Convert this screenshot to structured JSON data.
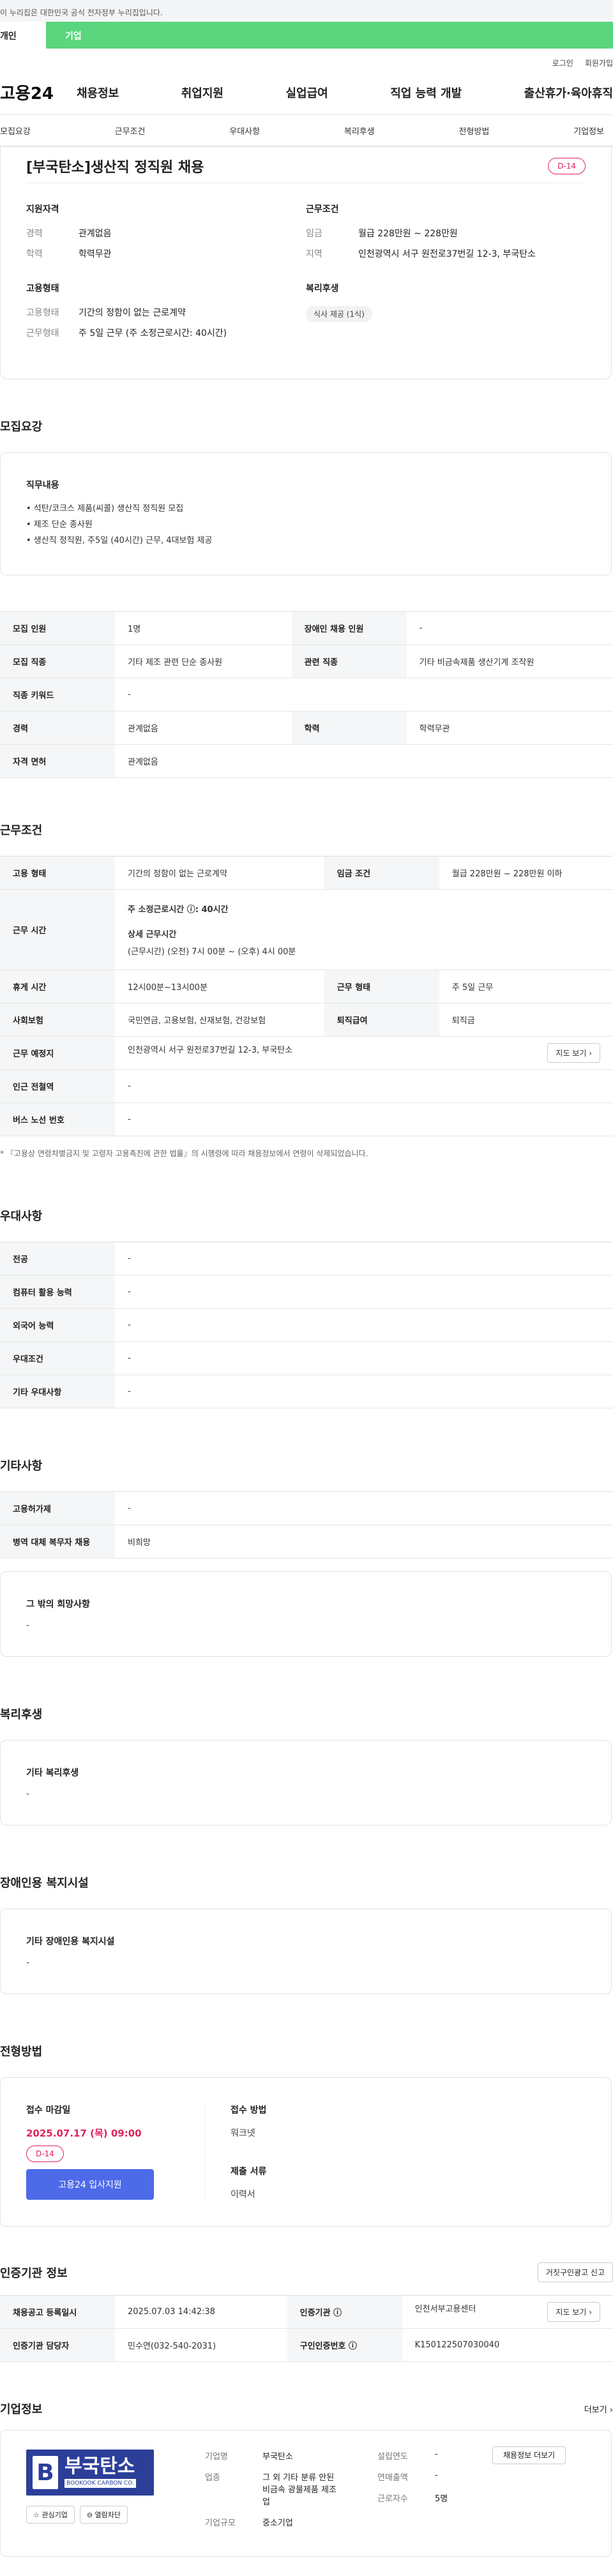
{
  "topbar": {
    "notice": "이 누리집은 대한민국 공식 전자정부 누리집입니다."
  },
  "audience_tabs": {
    "left": "개인",
    "right": "기업"
  },
  "utility": {
    "login": "로그인",
    "signup": "회원가입"
  },
  "gnb": {
    "logo": "고용24",
    "menu": [
      "채용정보",
      "취업지원",
      "실업급여",
      "직업 능력 개발",
      "출산휴가·육아휴직"
    ]
  },
  "lnb": [
    "모집요강",
    "근무조건",
    "우대사항",
    "복리후생",
    "전형방법",
    "기업정보"
  ],
  "job": {
    "title": "[부국탄소]생산직 정직원 채용",
    "dday": "D-14",
    "qualification": {
      "heading": "지원자격",
      "career_k": "경력",
      "career_v": "관계없음",
      "edu_k": "학력",
      "edu_v": "학력무관"
    },
    "employment": {
      "heading": "고용형태",
      "type_k": "고용형태",
      "type_v": "기간의 정함이 없는 근로계약",
      "hours_k": "근무형태",
      "hours_v": "주 5일 근무 (주 소정근로시간: 40시간)"
    },
    "conditions": {
      "heading": "근무조건",
      "wage_k": "임금",
      "wage_v": "월급 228만원 ~ 228만원",
      "region_k": "지역",
      "region_v": "인천광역시 서구 원전로37번길 12-3, 부국탄소"
    },
    "welfare": {
      "heading": "복리후생",
      "chip": "식사 제공 (1식)"
    }
  },
  "recruit": {
    "title": "모집요강",
    "duty_heading": "직무내용",
    "duties": [
      "• 석탄/코크스 제품(씨콜) 생산직 정직원 모집",
      "• 제조 단순 종사원",
      "• 생산직 정직원, 주5일 (40시간) 근무, 4대보험 제공"
    ],
    "rows": [
      {
        "h1": "모집 인원",
        "v1": "1명",
        "h2": "장애인 채용 인원",
        "v2": "-"
      },
      {
        "h1": "모집 직종",
        "v1": "기타 제조 관련 단순 종사원",
        "h2": "관련 직종",
        "v2": "기타 비금속제품 생산기계 조작원"
      },
      {
        "h1": "직종 키워드",
        "v1": "-"
      },
      {
        "h1": "경력",
        "v1": "관계없음",
        "h2": "학력",
        "v2": "학력무관"
      },
      {
        "h1": "자격 면허",
        "v1": "관계없음"
      }
    ]
  },
  "work": {
    "title": "근무조건",
    "r1": {
      "h1": "고용 형태",
      "v1": "기간의 정함이 없는 근로계약",
      "h2": "임금 조건",
      "v2": "월급 228만원 ~ 228만원 이하"
    },
    "r2": {
      "h": "근무 시간",
      "weekly": "주 소정근로시간 ⓘ: 40시간",
      "detail_h": "상세 근무시간",
      "detail_v": "(근무시간) (오전) 7시 00분 ~ (오후) 4시 00분"
    },
    "r3": {
      "h1": "휴게 시간",
      "v1": "12시00분~13시00분",
      "h2": "근무 형태",
      "v2": "주 5일 근무"
    },
    "r4": {
      "h1": "사회보험",
      "v1": "국민연금, 고용보험, 산재보험, 건강보험",
      "h2": "퇴직급여",
      "v2": "퇴직금"
    },
    "r5": {
      "h": "근무 예정지",
      "v": "인천광역시 서구 원전로37번길 12-3, 부국탄소",
      "btn": "지도 보기 ›"
    },
    "r6": {
      "h": "인근 전철역",
      "v": "-"
    },
    "r7": {
      "h": "버스 노선 번호",
      "v": "-"
    },
    "note": "* 『고용상 연령차별금지 및 고령자 고용촉진에 관한 법률』의 시행령에 따라 채용정보에서 연령이 삭제되었습니다."
  },
  "pref": {
    "title": "우대사항",
    "rows": [
      {
        "h": "전공",
        "v": "-"
      },
      {
        "h": "컴퓨터 활용 능력",
        "v": "-"
      },
      {
        "h": "외국어 능력",
        "v": "-"
      },
      {
        "h": "우대조건",
        "v": "-"
      },
      {
        "h": "기타 우대사항",
        "v": "-"
      }
    ]
  },
  "other": {
    "title": "기타사항",
    "rows": [
      {
        "h": "고용허가제",
        "v": "-"
      },
      {
        "h": "병역 대체 복무자 채용",
        "v": "비희망"
      }
    ],
    "card_h": "그 밖의 희망사항",
    "card_v": "-"
  },
  "benefits": {
    "title": "복리후생",
    "card_h": "기타 복리후생",
    "card_v": "-"
  },
  "disabled": {
    "title": "장애인용 복지시설",
    "card_h": "기타 장애인용 복지시설",
    "card_v": "-"
  },
  "selection": {
    "title": "전형방법",
    "deadline_h": "접수 마감일",
    "deadline_v": "2025.07.17 (목) 09:00",
    "dday": "D-14",
    "apply_btn": "고용24 입사지원",
    "method_h": "접수 방법",
    "method_v": "워크넷",
    "docs_h": "제출 서류",
    "docs_v": "이력서"
  },
  "cert": {
    "title": "인증기관 정보",
    "report_btn": "거짓구인광고 신고",
    "r1": {
      "h1": "채용공고 등록일시",
      "v1": "2025.07.03 14:42:38",
      "h2": "인증기관 ⓘ",
      "v2": "인천서부고용센터",
      "btn": "지도 보기 ›"
    },
    "r2": {
      "h1": "인증기관 담당자",
      "v1": "민수연(032-540-2031)",
      "h2": "구인인증번호 ⓘ",
      "v2": "K150122507030040"
    }
  },
  "company": {
    "title": "기업정보",
    "more": "더보기 ›",
    "logo_ko": "부국탄소",
    "logo_en": "BOOKOOK CARBON CO.",
    "logo_b": "B",
    "interest_btn": "☆ 관심기업",
    "block_btn": "⊖ 열람차단",
    "col1": [
      {
        "k": "기업명",
        "v": "부국탄소"
      },
      {
        "k": "업종",
        "v": "그 외 기타 분류 안된 비금속 광물제품 제조업"
      },
      {
        "k": "기업규모",
        "v": "중소기업"
      }
    ],
    "col2": [
      {
        "k": "설립연도",
        "v": "-"
      },
      {
        "k": "연매출액",
        "v": "-"
      },
      {
        "k": "근로자수",
        "v": "5명"
      }
    ],
    "jobs_btn": "채용정보 더보기"
  }
}
